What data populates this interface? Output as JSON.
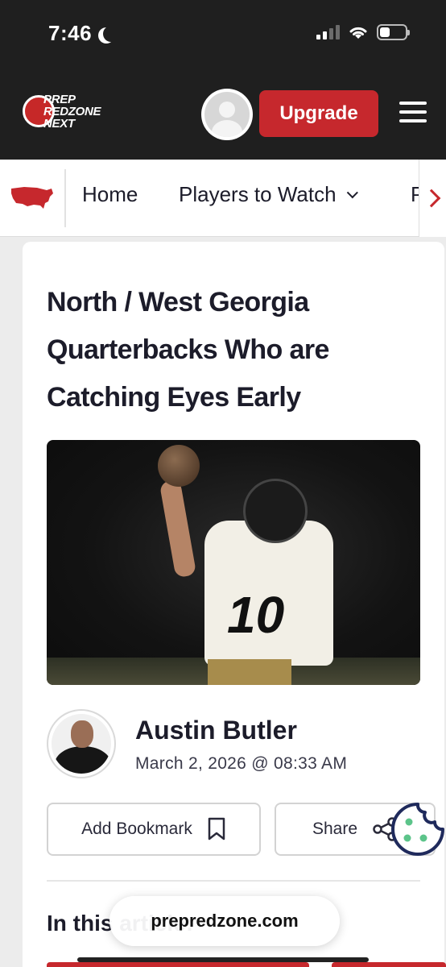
{
  "status_bar": {
    "time": "7:46"
  },
  "header": {
    "logo_line1": "PREP",
    "logo_line2": "REDZONE",
    "logo_line3": "NEXT",
    "upgrade_label": "Upgrade"
  },
  "nav": {
    "items": [
      {
        "label": "Home"
      },
      {
        "label": "Players to Watch"
      },
      {
        "label": "P"
      }
    ]
  },
  "article": {
    "title": "North / West Georgia Quarterbacks Who are Catching Eyes Early",
    "hero_jersey_number": "10",
    "author_name": "Austin Butler",
    "date": "March 2, 2026 @ 08:33 AM",
    "bookmark_label": "Add Bookmark",
    "share_label": "Share",
    "section_heading": "In this article:"
  },
  "browser": {
    "url": "prepredzone.com"
  },
  "colors": {
    "brand_red": "#c6282d",
    "header_bg": "#1f1f1f",
    "cookie_accent": "#5cc48a",
    "cookie_outline": "#1f2a5c"
  }
}
